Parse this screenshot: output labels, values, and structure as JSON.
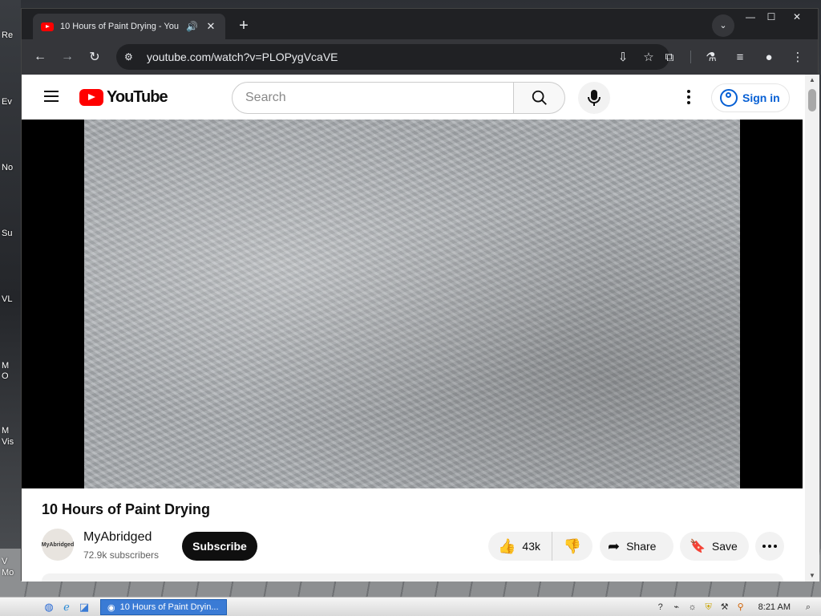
{
  "desktop": {
    "labels": [
      "Re",
      "Ev",
      "No",
      "Su",
      "VL",
      "M",
      "O",
      "M",
      "Vis",
      "V",
      "Mo"
    ]
  },
  "browser": {
    "tab": {
      "title": "10 Hours of Paint Drying - You",
      "audio_icon": "speaker-icon",
      "close": "✕"
    },
    "new_tab": "+",
    "url": "youtube.com/watch?v=PLOPygVcaVE",
    "window_controls": {
      "minimize": "—",
      "maximize": "☐",
      "close": "✕"
    }
  },
  "youtube": {
    "logo_text": "YouTube",
    "search_placeholder": "Search",
    "sign_in": "Sign in",
    "video": {
      "title": "10 Hours of Paint Drying",
      "channel": {
        "name": "MyAbridged",
        "avatar_text": "MyAbridged",
        "subscribers": "72.9k subscribers"
      },
      "subscribe": "Subscribe",
      "likes": "43k",
      "share": "Share",
      "save": "Save"
    }
  },
  "taskbar": {
    "window_button": "10 Hours of Paint Dryin...",
    "clock": "8:21 AM"
  }
}
